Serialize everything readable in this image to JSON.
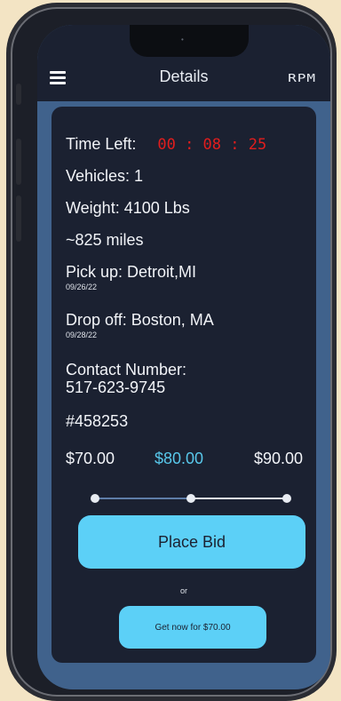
{
  "header": {
    "title": "Details",
    "logo_text": "RPM",
    "menu_icon": "hamburger-menu-icon"
  },
  "details": {
    "time_left_label": "Time Left:",
    "time_left_value": "00 : 08 : 25",
    "vehicles": "Vehicles: 1",
    "weight": "Weight: 4100 Lbs",
    "distance": "~825 miles",
    "pickup": "Pick up: Detroit,MI",
    "pickup_date": "09/26/22",
    "dropoff": "Drop off: Boston, MA",
    "dropoff_date": "09/28/22",
    "contact_label": "Contact Number:",
    "contact_number": "517-623-9745",
    "order_id": "#458253"
  },
  "bid": {
    "min": "$70.00",
    "selected": "$80.00",
    "max": "$90.00",
    "slider_position_fraction": 0.5,
    "place_bid_label": "Place Bid",
    "or_label": "or",
    "get_now_label": "Get now for $70.00"
  },
  "colors": {
    "background": "#f3e4c4",
    "screen_frame": "#40628c",
    "card": "#1b2131",
    "accent": "#5cd0f7",
    "timer": "#e11d1d"
  }
}
